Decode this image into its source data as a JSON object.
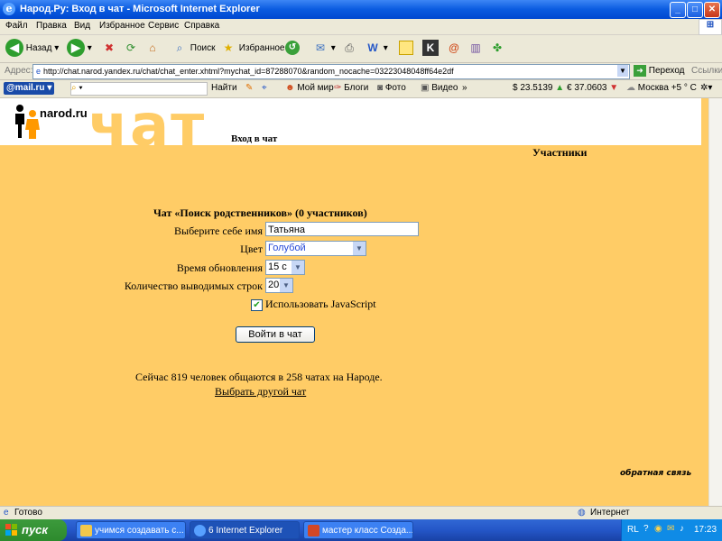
{
  "window": {
    "title": "Народ.Ру: Вход в чат - Microsoft Internet Explorer"
  },
  "menu": [
    "Файл",
    "Правка",
    "Вид",
    "Избранное",
    "Сервис",
    "Справка"
  ],
  "toolbar": {
    "back": "Назад",
    "search": "Поиск",
    "favorites": "Избранное"
  },
  "address": {
    "label": "Адрес:",
    "url": "http://chat.narod.yandex.ru/chat/chat_enter.xhtml?mychat_id=87288070&random_nocache=0322304804​8ff64e2df",
    "go": "Переход",
    "links": "Ссылки"
  },
  "mailbar": {
    "logo": "@mail.ru",
    "find": "Найти",
    "myworld": "Мой мир",
    "blogs": "Блоги",
    "photo": "Фото",
    "video": "Видео",
    "usd": "$ 23.5139",
    "eur": "€ 37.0603",
    "weather": "Москва +5 ° C"
  },
  "page": {
    "logo_text": "narod.ru",
    "chat_word": "чат",
    "section_title": "Вход в чат",
    "participants_title": "Участники",
    "form_title": "Чат «Поиск родственников» (0 участников)",
    "name_label": "Выберите себе имя",
    "name_value": "Татьяна",
    "color_label": "Цвет",
    "color_value": "Голубой",
    "refresh_label": "Время обновления",
    "refresh_value": "15 с",
    "rows_label": "Количество выводимых строк",
    "rows_value": "20",
    "js_label": "Использовать JavaScript",
    "js_checked": true,
    "enter_button": "Войти в чат",
    "stats_text": "Сейчас 819 человек общаются в 258 чатах на Народе.",
    "other_chat_link": "Выбрать другой чат",
    "feedback": "обратная связь"
  },
  "status": {
    "left": "Готово",
    "zone": "Интернет"
  },
  "taskbar": {
    "start": "пуск",
    "tasks": [
      "учимся создавать с...",
      "6 Internet Explorer",
      "мастер класс Созда..."
    ],
    "lang": "RL",
    "clock": "17:23"
  },
  "colors": {
    "page_bg": "#FFCC66",
    "xp_blue": "#0A5BE0",
    "start_green": "#3C9A3C"
  }
}
